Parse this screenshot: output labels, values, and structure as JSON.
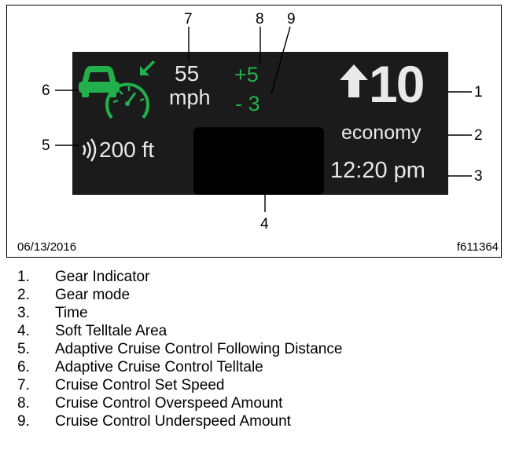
{
  "display": {
    "set_speed_value": "55",
    "set_speed_unit": "mph",
    "overspeed": "+5",
    "underspeed": "- 3",
    "gear": "10",
    "gear_mode": "economy",
    "following_distance": "200 ft",
    "time": "12:20 pm",
    "colors": {
      "background": "#1b1b1b",
      "green": "#21b04b",
      "text": "#e9e9e9"
    },
    "icons": [
      "acc-car-speedometer-icon",
      "radar-waves-icon",
      "up-arrow-icon"
    ]
  },
  "callouts": [
    "1",
    "2",
    "3",
    "4",
    "5",
    "6",
    "7",
    "8",
    "9"
  ],
  "footer": {
    "date": "06/13/2016",
    "figure_id": "f611364"
  },
  "legend": [
    {
      "num": "1.",
      "text": "Gear Indicator"
    },
    {
      "num": "2.",
      "text": "Gear mode"
    },
    {
      "num": "3.",
      "text": "Time"
    },
    {
      "num": "4.",
      "text": "Soft Telltale Area"
    },
    {
      "num": "5.",
      "text": "Adaptive Cruise Control Following Distance"
    },
    {
      "num": "6.",
      "text": "Adaptive Cruise Control Telltale"
    },
    {
      "num": "7.",
      "text": "Cruise Control Set Speed"
    },
    {
      "num": "8.",
      "text": "Cruise Control Overspeed Amount"
    },
    {
      "num": "9.",
      "text": "Cruise Control Underspeed Amount"
    }
  ]
}
